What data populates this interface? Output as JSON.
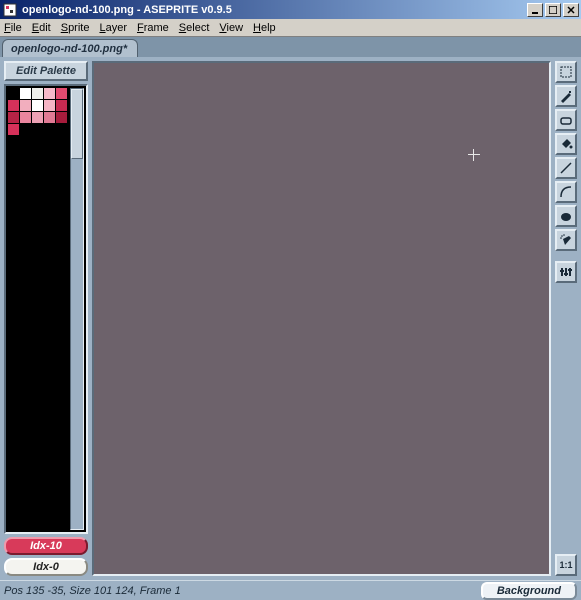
{
  "window": {
    "title": "openlogo-nd-100.png - ASEPRITE v0.9.5"
  },
  "menus": [
    {
      "label": "File",
      "accel": "F"
    },
    {
      "label": "Edit",
      "accel": "E"
    },
    {
      "label": "Sprite",
      "accel": "S"
    },
    {
      "label": "Layer",
      "accel": "L"
    },
    {
      "label": "Frame",
      "accel": "F"
    },
    {
      "label": "Select",
      "accel": "S"
    },
    {
      "label": "View",
      "accel": "V"
    },
    {
      "label": "Help",
      "accel": "H"
    }
  ],
  "tab": {
    "label": "openlogo-nd-100.png*"
  },
  "palette": {
    "edit_label": "Edit Palette",
    "swatches": [
      "#000000",
      "#ffffff",
      "#f0f0ec",
      "#f7bac9",
      "#e24a6e",
      "#d6315a",
      "#f2aebe",
      "#ffffff",
      "#f5b4c4",
      "#c62a50",
      "#b82346",
      "#e9859e",
      "#eda0b4",
      "#e07a94",
      "#a61c3c",
      "#d6315a"
    ],
    "fg_label": "Idx-10",
    "bg_label": "Idx-0"
  },
  "tools": [
    {
      "id": "marquee",
      "name": "marquee-tool"
    },
    {
      "id": "pencil",
      "name": "pencil-tool"
    },
    {
      "id": "eraser",
      "name": "eraser-tool"
    },
    {
      "id": "bucket",
      "name": "bucket-tool"
    },
    {
      "id": "line",
      "name": "line-tool"
    },
    {
      "id": "curve",
      "name": "curve-tool"
    },
    {
      "id": "blur",
      "name": "blur-tool"
    },
    {
      "id": "spray",
      "name": "spray-tool"
    },
    {
      "id": "config",
      "name": "configure-tool"
    }
  ],
  "zoom": {
    "label": "1:1"
  },
  "status": {
    "text": "Pos 135 -35, Size 101 124, Frame 1",
    "layer_button": "Background"
  }
}
